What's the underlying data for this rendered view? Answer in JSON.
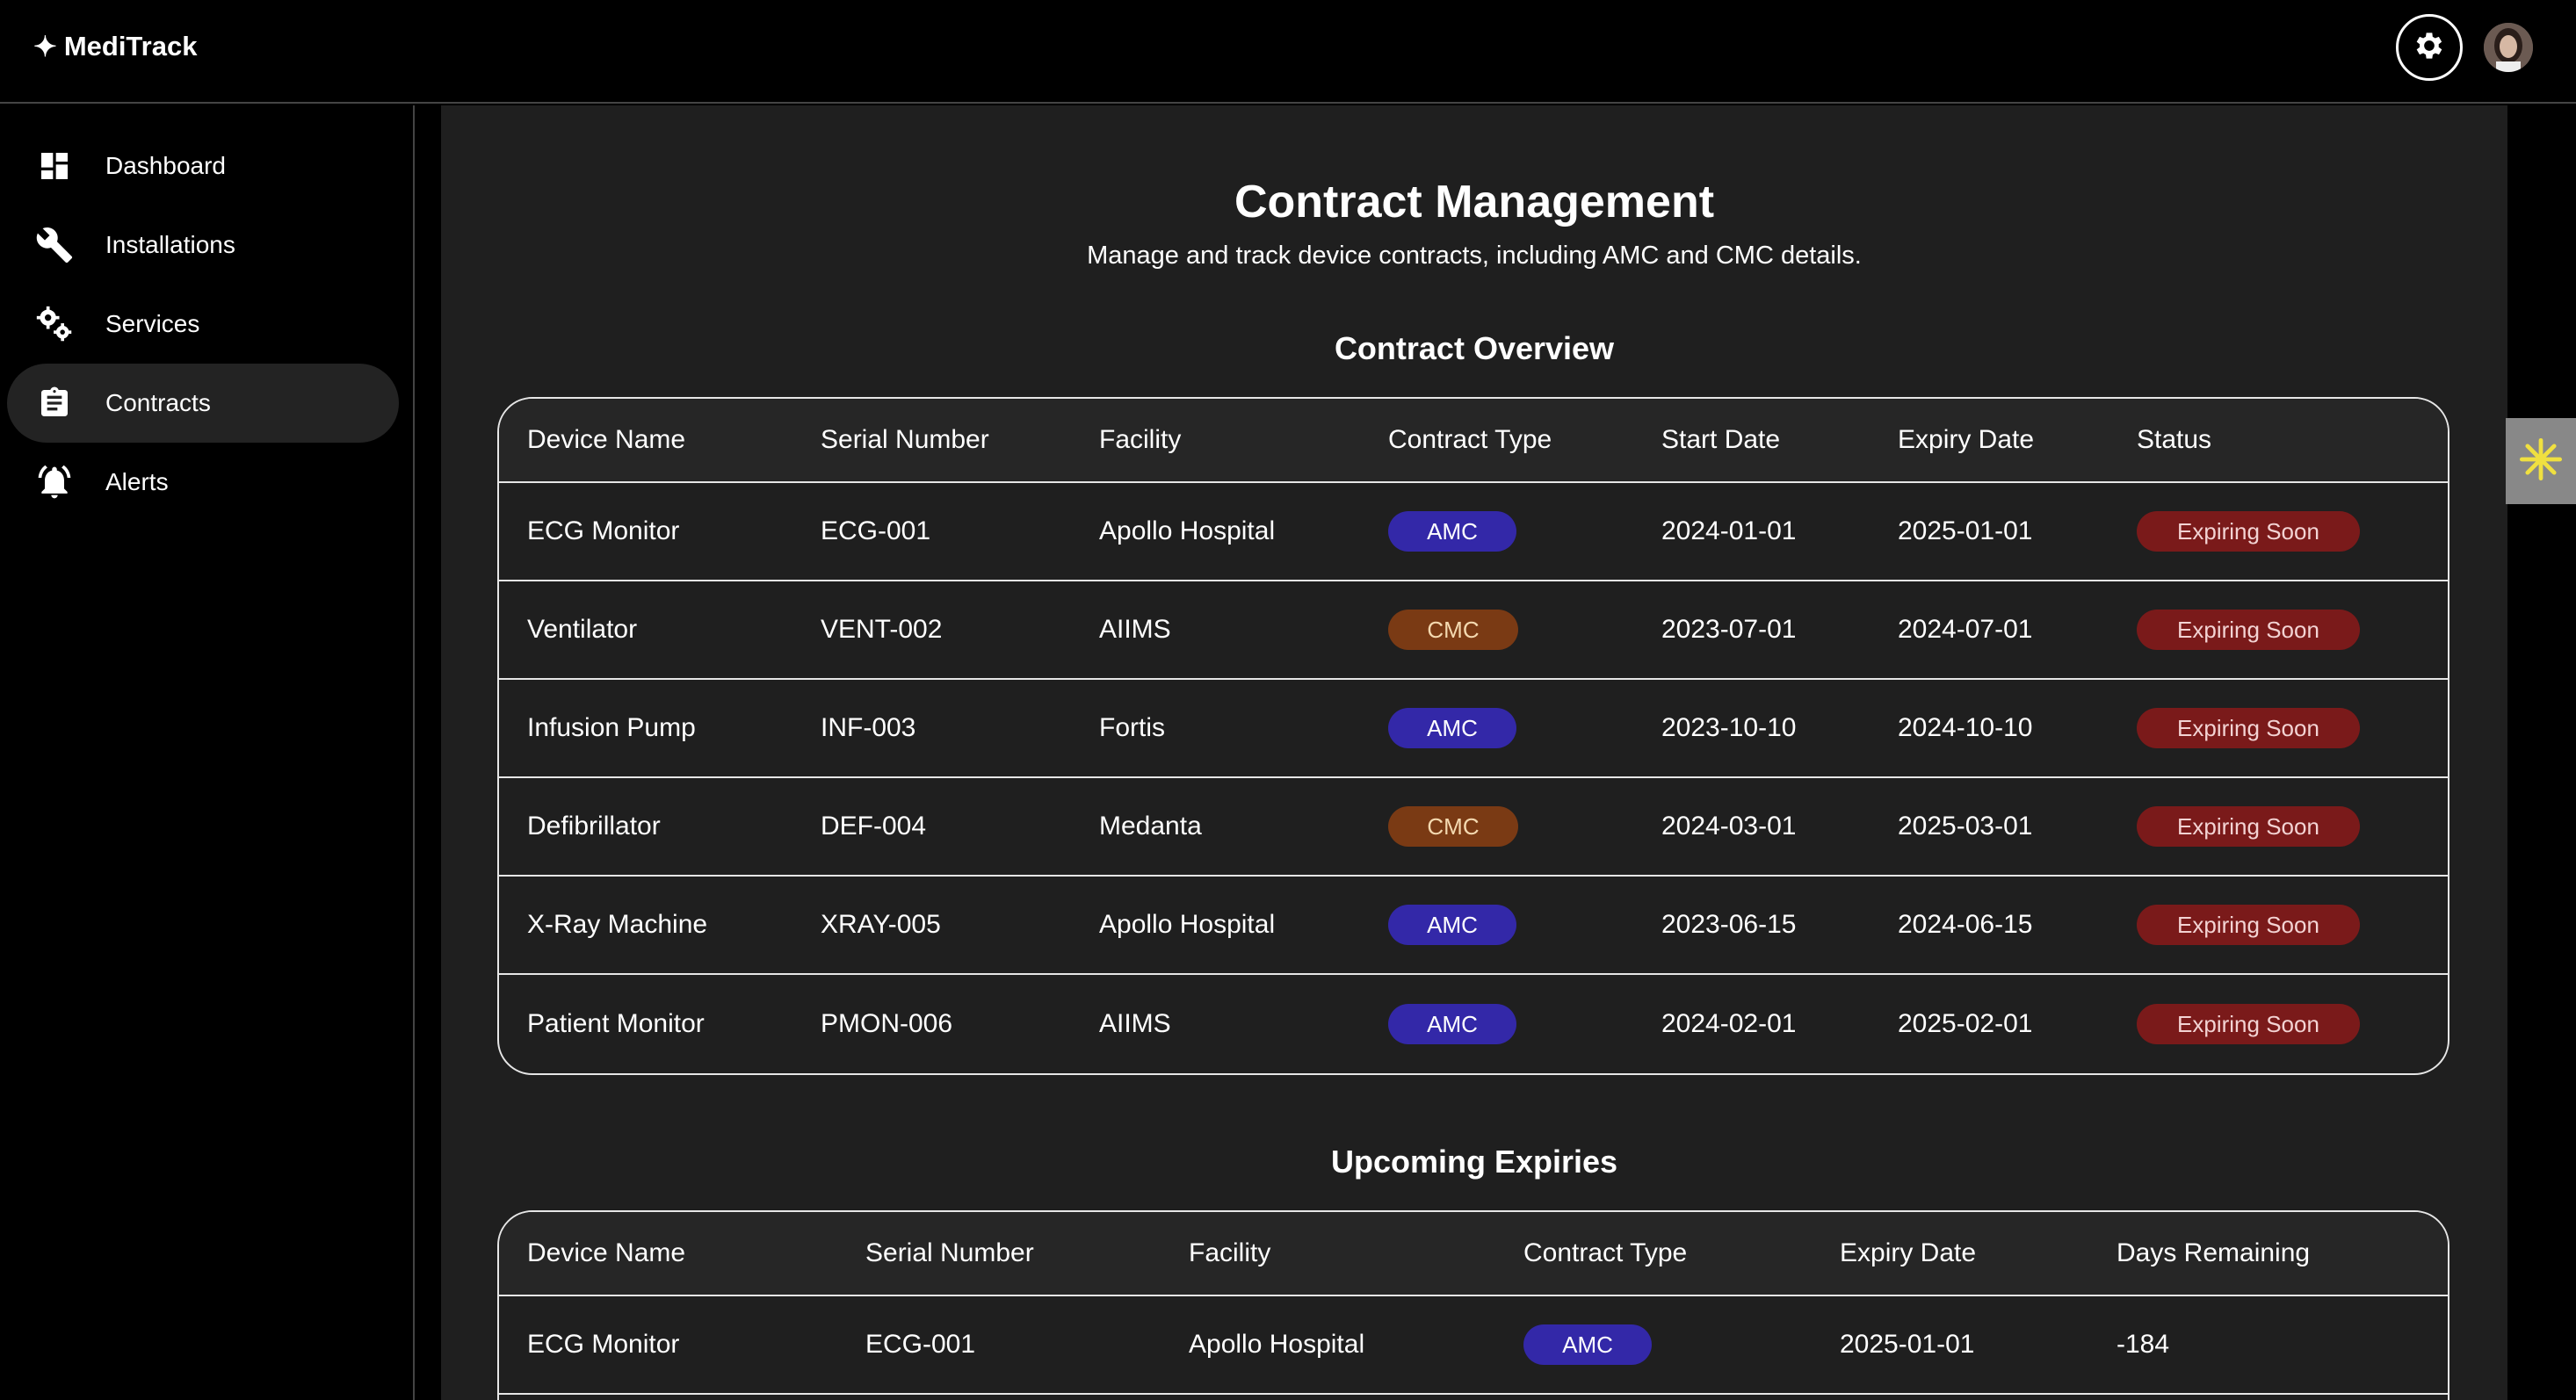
{
  "app": {
    "brand": "MediTrack",
    "brand_glyph": "✦"
  },
  "sidebar": {
    "items": [
      {
        "label": "Dashboard",
        "icon": "dashboard-icon",
        "active": false
      },
      {
        "label": "Installations",
        "icon": "wrench-icon",
        "active": false
      },
      {
        "label": "Services",
        "icon": "gears-icon",
        "active": false
      },
      {
        "label": "Contracts",
        "icon": "clipboard-icon",
        "active": true
      },
      {
        "label": "Alerts",
        "icon": "bell-icon",
        "active": false
      }
    ]
  },
  "main": {
    "title": "Contract Management",
    "subtitle": "Manage and track device contracts, including AMC and CMC details."
  },
  "overview": {
    "title": "Contract Overview",
    "headers": [
      "Device Name",
      "Serial Number",
      "Facility",
      "Contract Type",
      "Start Date",
      "Expiry Date",
      "Status"
    ],
    "rows": [
      {
        "device": "ECG Monitor",
        "serial": "ECG-001",
        "facility": "Apollo Hospital",
        "type": "AMC",
        "start": "2024-01-01",
        "expiry": "2025-01-01",
        "status": "Expiring Soon"
      },
      {
        "device": "Ventilator",
        "serial": "VENT-002",
        "facility": "AIIMS",
        "type": "CMC",
        "start": "2023-07-01",
        "expiry": "2024-07-01",
        "status": "Expiring Soon"
      },
      {
        "device": "Infusion Pump",
        "serial": "INF-003",
        "facility": "Fortis",
        "type": "AMC",
        "start": "2023-10-10",
        "expiry": "2024-10-10",
        "status": "Expiring Soon"
      },
      {
        "device": "Defibrillator",
        "serial": "DEF-004",
        "facility": "Medanta",
        "type": "CMC",
        "start": "2024-03-01",
        "expiry": "2025-03-01",
        "status": "Expiring Soon"
      },
      {
        "device": "X-Ray Machine",
        "serial": "XRAY-005",
        "facility": "Apollo Hospital",
        "type": "AMC",
        "start": "2023-06-15",
        "expiry": "2024-06-15",
        "status": "Expiring Soon"
      },
      {
        "device": "Patient Monitor",
        "serial": "PMON-006",
        "facility": "AIIMS",
        "type": "AMC",
        "start": "2024-02-01",
        "expiry": "2025-02-01",
        "status": "Expiring Soon"
      }
    ]
  },
  "upcoming": {
    "title": "Upcoming Expiries",
    "headers": [
      "Device Name",
      "Serial Number",
      "Facility",
      "Contract Type",
      "Expiry Date",
      "Days Remaining"
    ],
    "rows": [
      {
        "device": "ECG Monitor",
        "serial": "ECG-001",
        "facility": "Apollo Hospital",
        "type": "AMC",
        "expiry": "2025-01-01",
        "days": "-184"
      }
    ]
  },
  "colors": {
    "amc": "#3328a8",
    "cmc": "#7a3a14",
    "expiring": "#7a1a1a",
    "active_nav": "#232323",
    "widget_accent": "#f0e040"
  }
}
